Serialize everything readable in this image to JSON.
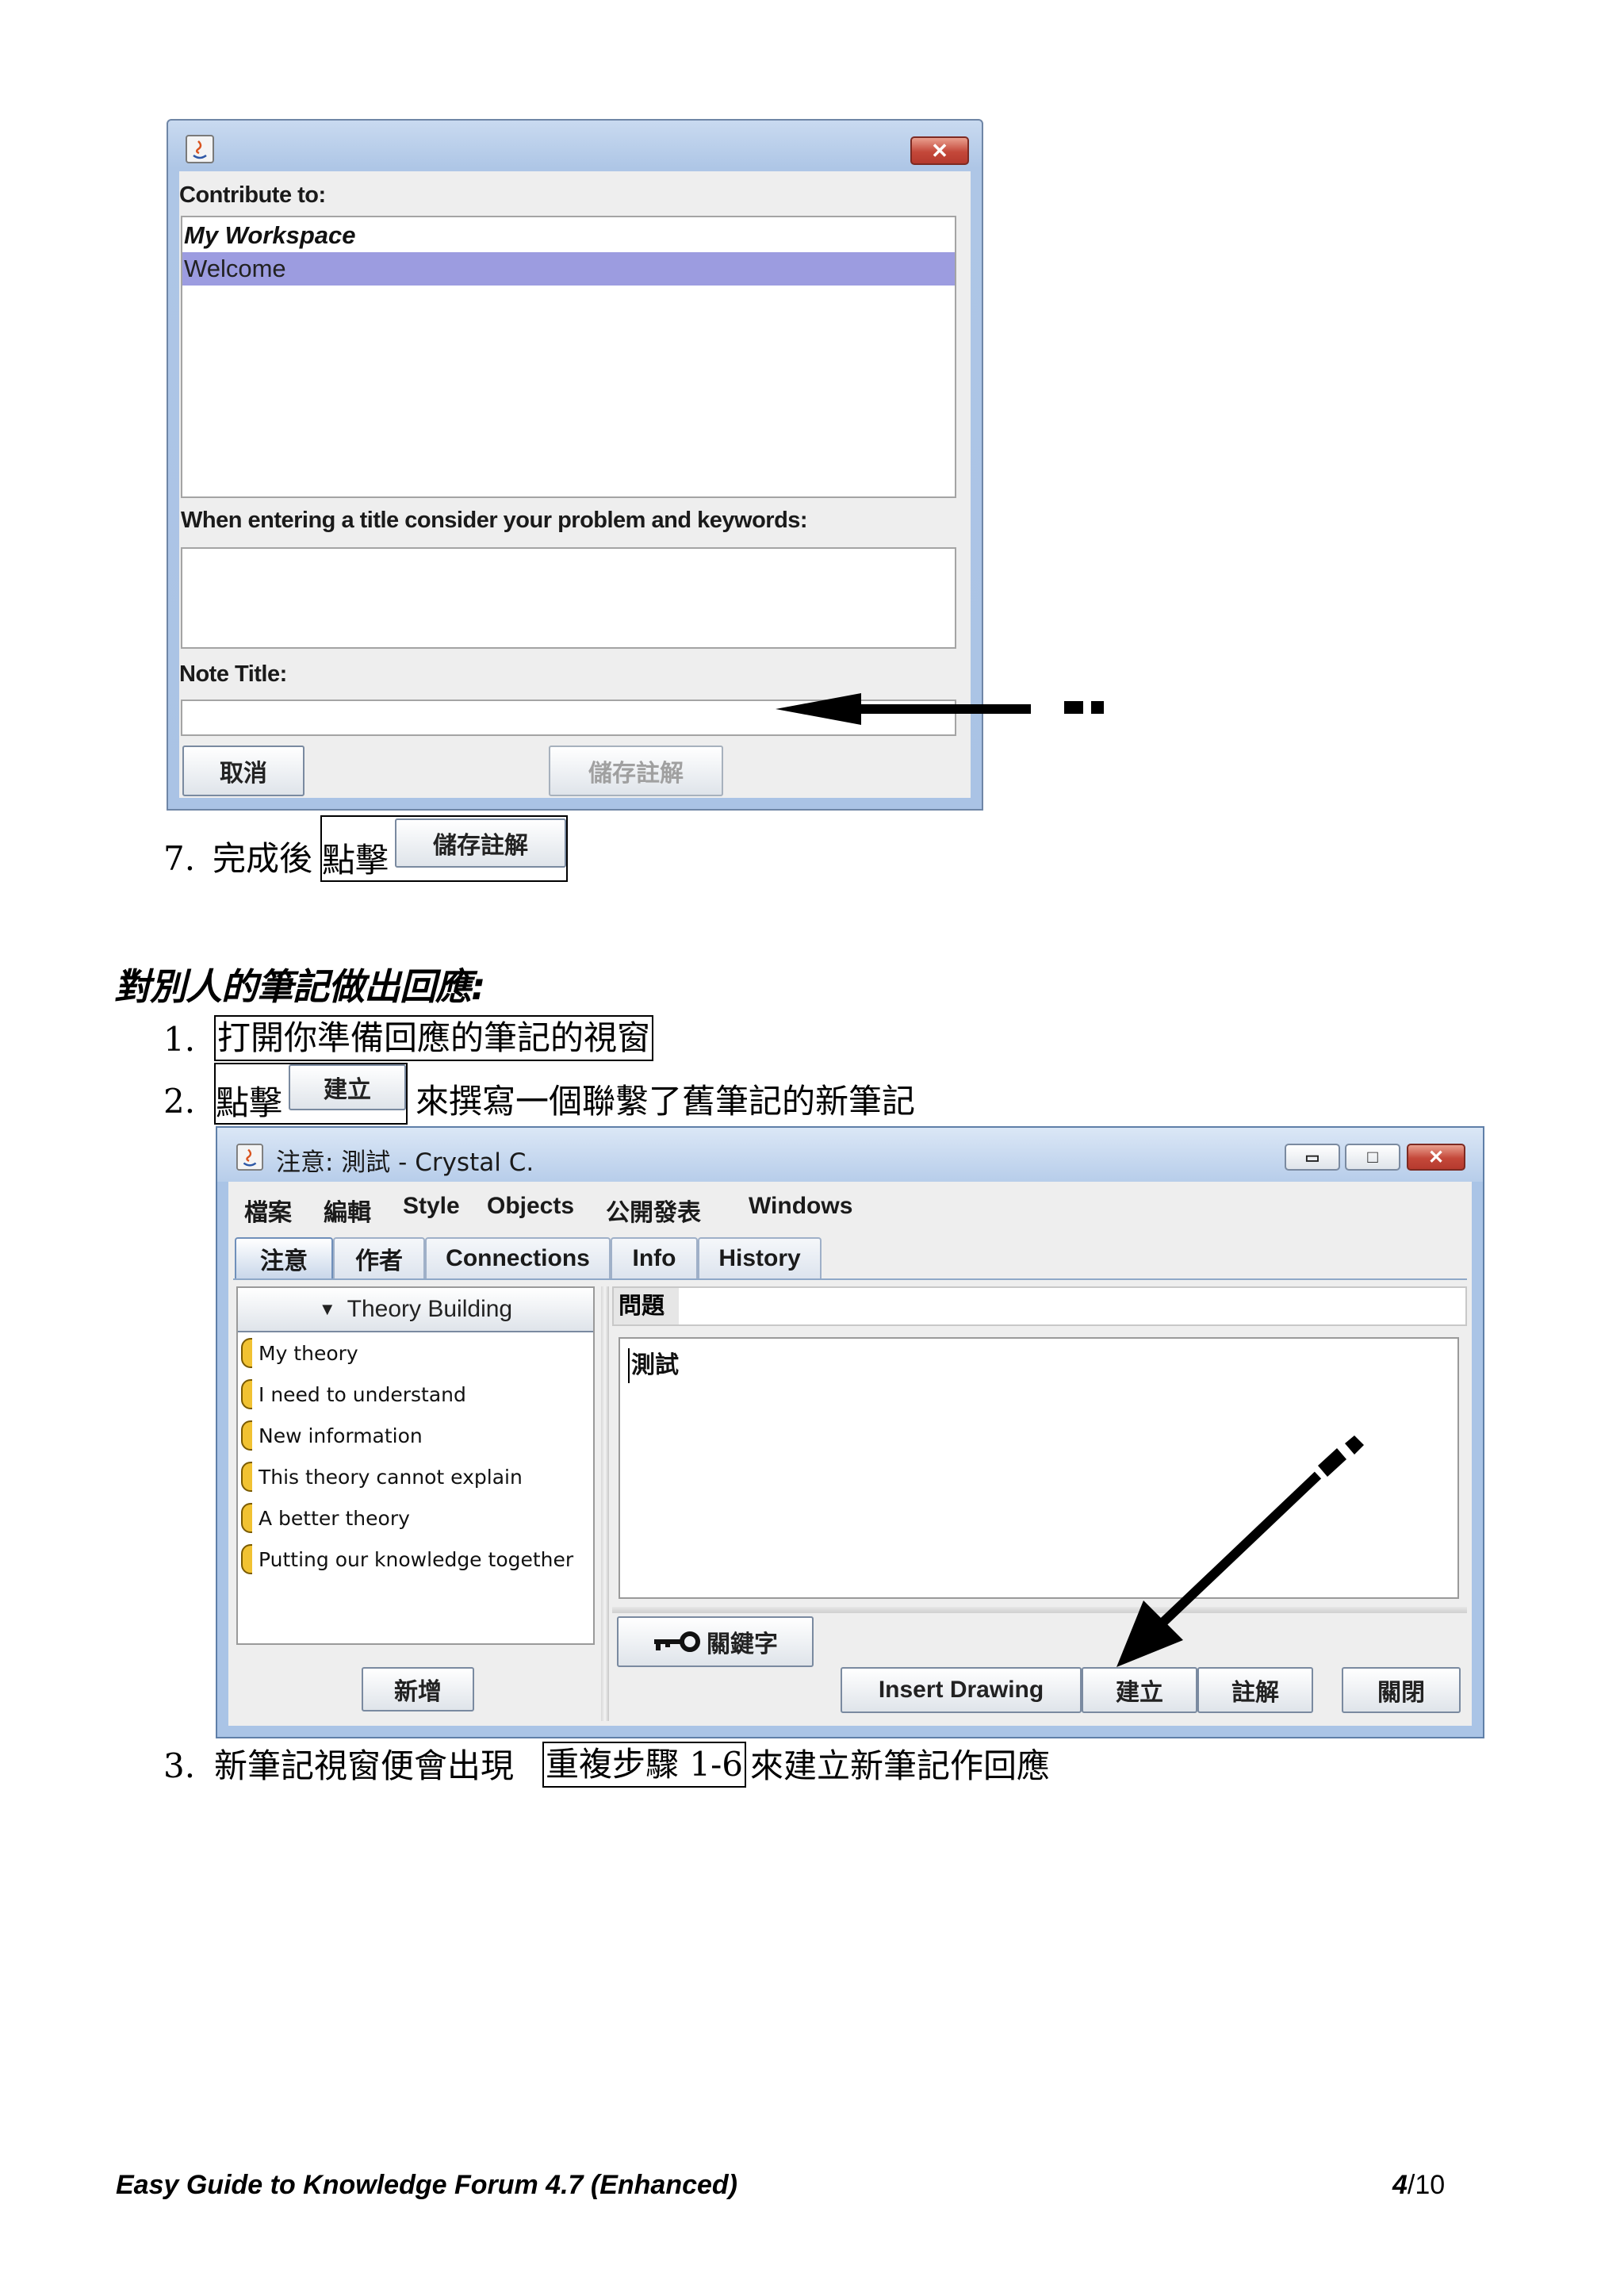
{
  "dialog1": {
    "close_symbol": "✕",
    "contribute_label": "Contribute to:",
    "workspace_items": [
      "My Workspace",
      "Welcome"
    ],
    "selected_color": "#9c9ce0",
    "title_hint_label": "When entering a title consider your problem and keywords:",
    "note_title_label": "Note Title:",
    "note_title_value": "",
    "cancel_label": "取消",
    "save_label": "儲存註解"
  },
  "step7": {
    "number": "7.",
    "text_before": "完成後",
    "text_click": "點擊",
    "button_label": "儲存註解"
  },
  "section_heading": "對別人的筆記做出回應:",
  "steps": {
    "s1_number": "1.",
    "s1_text": "打開你準備回應的筆記的視窗",
    "s2_number": "2.",
    "s2_click": "點擊",
    "s2_button": "建立",
    "s2_text_after": "來撰寫一個聯繫了舊筆記的新筆記",
    "s3_number": "3.",
    "s3_text_before": "新筆記視窗便會出現",
    "s3_boxed": "重複步驟 1-6",
    "s3_text_after": "來建立新筆記作回應"
  },
  "window2": {
    "title": "注意: 測試 - Crystal C.",
    "controls": {
      "minimize": "▭",
      "maximize": "□",
      "close": "✕"
    },
    "menu": [
      "檔案",
      "編輯",
      "Style",
      "Objects",
      "公開發表",
      "Windows"
    ],
    "tabs": [
      "注意",
      "作者",
      "Connections",
      "Info",
      "History"
    ],
    "scaffold_title": "Theory Building",
    "scaffolds": [
      "My theory",
      "I need to understand",
      "New information",
      "This theory cannot explain",
      "A better theory",
      "Putting our knowledge together"
    ],
    "scaffold_color": "#f1c232",
    "problem_label": "問題",
    "problem_value": "",
    "body_text": "測試",
    "keyword_label": "關鍵字",
    "add_label": "新增",
    "buttons": [
      "Insert Drawing",
      "建立",
      "註解",
      "關閉"
    ]
  },
  "footer": {
    "title": "Easy Guide to Knowledge Forum 4.7 (Enhanced)",
    "page_current": "4",
    "page_total": "/10"
  }
}
